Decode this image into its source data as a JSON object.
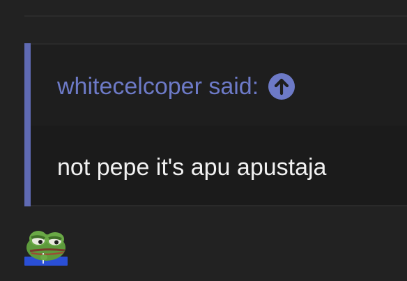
{
  "quote": {
    "author_label": "whitecelcoper said:",
    "body_text": "not pepe it's apu apustaja",
    "jump_icon": "arrow-up-circle-icon"
  },
  "reaction": {
    "emoji_icon": "apu-frog-emoji"
  },
  "colors": {
    "background": "#222222",
    "quote_accent": "#5f6ab3",
    "author_text": "#6d7ac7",
    "body_text": "#f1f1f1"
  }
}
